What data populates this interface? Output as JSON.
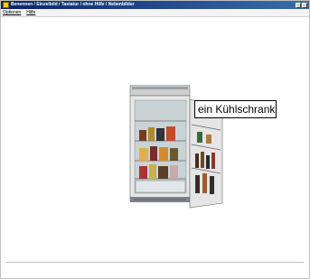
{
  "window": {
    "title": "Benennen / Einzelbild / Tastatur / ohne Hilfe / Nebenbilder"
  },
  "menu": {
    "items": [
      "Optionen",
      "Hilfe"
    ]
  },
  "picture": {
    "label": "ein Kühlschrank",
    "icon": "fridge-image"
  }
}
